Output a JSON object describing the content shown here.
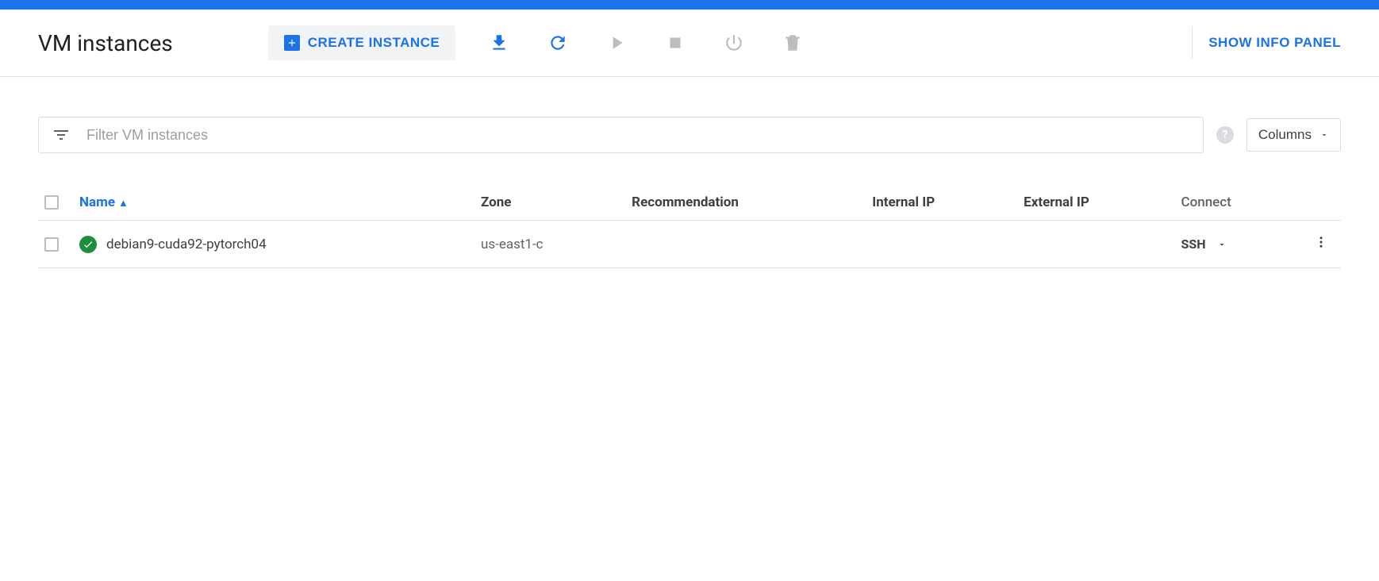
{
  "header": {
    "title": "VM instances",
    "create_label": "CREATE INSTANCE",
    "info_panel_label": "SHOW INFO PANEL"
  },
  "filter": {
    "placeholder": "Filter VM instances",
    "columns_label": "Columns"
  },
  "table": {
    "columns": {
      "name": "Name",
      "zone": "Zone",
      "recommendation": "Recommendation",
      "internal_ip": "Internal IP",
      "external_ip": "External IP",
      "connect": "Connect"
    },
    "rows": [
      {
        "name": "debian9-cuda92-pytorch04",
        "zone": "us-east1-c",
        "recommendation": "",
        "internal_ip": "",
        "external_ip": "",
        "connect": "SSH",
        "status": "running"
      }
    ]
  }
}
